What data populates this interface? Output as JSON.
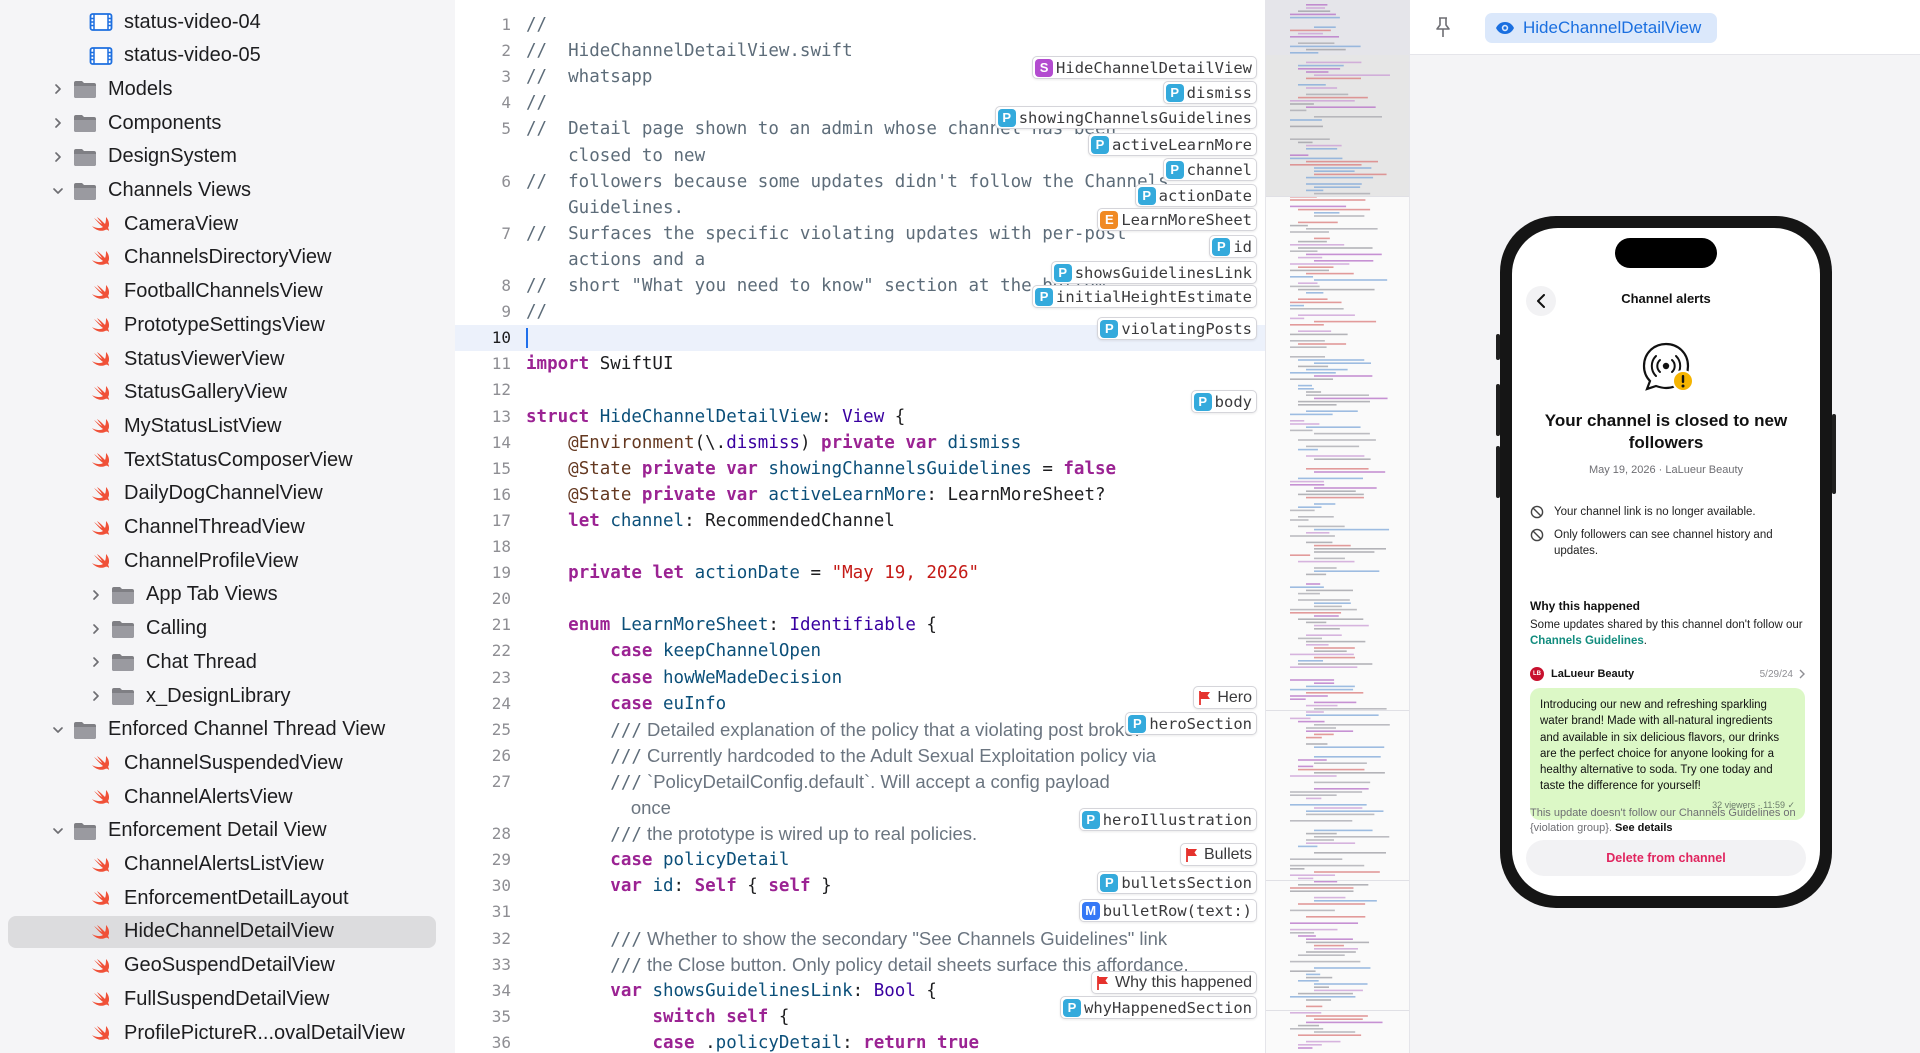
{
  "sidebar": {
    "items": [
      {
        "label": "status-video-04",
        "icon": "video-file-icon",
        "indent": 2,
        "chevron": "none"
      },
      {
        "label": "status-video-05",
        "icon": "video-file-icon",
        "indent": 2,
        "chevron": "none"
      },
      {
        "label": "Models",
        "icon": "folder-icon",
        "indent": 1,
        "chevron": "closed"
      },
      {
        "label": "Components",
        "icon": "folder-icon",
        "indent": 1,
        "chevron": "closed"
      },
      {
        "label": "DesignSystem",
        "icon": "folder-icon",
        "indent": 1,
        "chevron": "closed"
      },
      {
        "label": "Channels Views",
        "icon": "folder-icon",
        "indent": 1,
        "chevron": "open"
      },
      {
        "label": "CameraView",
        "icon": "swift-file-icon",
        "indent": 2,
        "chevron": "none"
      },
      {
        "label": "ChannelsDirectoryView",
        "icon": "swift-file-icon",
        "indent": 2,
        "chevron": "none"
      },
      {
        "label": "FootballChannelsView",
        "icon": "swift-file-icon",
        "indent": 2,
        "chevron": "none"
      },
      {
        "label": "PrototypeSettingsView",
        "icon": "swift-file-icon",
        "indent": 2,
        "chevron": "none"
      },
      {
        "label": "StatusViewerView",
        "icon": "swift-file-icon",
        "indent": 2,
        "chevron": "none"
      },
      {
        "label": "StatusGalleryView",
        "icon": "swift-file-icon",
        "indent": 2,
        "chevron": "none"
      },
      {
        "label": "MyStatusListView",
        "icon": "swift-file-icon",
        "indent": 2,
        "chevron": "none"
      },
      {
        "label": "TextStatusComposerView",
        "icon": "swift-file-icon",
        "indent": 2,
        "chevron": "none"
      },
      {
        "label": "DailyDogChannelView",
        "icon": "swift-file-icon",
        "indent": 2,
        "chevron": "none"
      },
      {
        "label": "ChannelThreadView",
        "icon": "swift-file-icon",
        "indent": 2,
        "chevron": "none"
      },
      {
        "label": "ChannelProfileView",
        "icon": "swift-file-icon",
        "indent": 2,
        "chevron": "none"
      },
      {
        "label": "App Tab Views",
        "icon": "folder-icon",
        "indent": 2,
        "chevron": "closed"
      },
      {
        "label": "Calling",
        "icon": "folder-icon",
        "indent": 2,
        "chevron": "closed"
      },
      {
        "label": "Chat Thread",
        "icon": "folder-icon",
        "indent": 2,
        "chevron": "closed"
      },
      {
        "label": "x_DesignLibrary",
        "icon": "folder-icon",
        "indent": 2,
        "chevron": "closed"
      },
      {
        "label": "Enforced Channel Thread View",
        "icon": "folder-icon",
        "indent": 1,
        "chevron": "open"
      },
      {
        "label": "ChannelSuspendedView",
        "icon": "swift-file-icon",
        "indent": 2,
        "chevron": "none"
      },
      {
        "label": "ChannelAlertsView",
        "icon": "swift-file-icon",
        "indent": 2,
        "chevron": "none"
      },
      {
        "label": "Enforcement Detail View",
        "icon": "folder-icon",
        "indent": 1,
        "chevron": "open"
      },
      {
        "label": "ChannelAlertsListView",
        "icon": "swift-file-icon",
        "indent": 2,
        "chevron": "none"
      },
      {
        "label": "EnforcementDetailLayout",
        "icon": "swift-file-icon",
        "indent": 2,
        "chevron": "none"
      },
      {
        "label": "HideChannelDetailView",
        "icon": "swift-file-icon",
        "indent": 2,
        "chevron": "none",
        "selected": true
      },
      {
        "label": "GeoSuspendDetailView",
        "icon": "swift-file-icon",
        "indent": 2,
        "chevron": "none"
      },
      {
        "label": "FullSuspendDetailView",
        "icon": "swift-file-icon",
        "indent": 2,
        "chevron": "none"
      },
      {
        "label": "ProfilePictureR...ovalDetailView",
        "icon": "swift-file-icon",
        "indent": 2,
        "chevron": "none"
      }
    ]
  },
  "editor": {
    "current_line": 10,
    "lines": [
      {
        "n": "1",
        "segs": [
          [
            "c",
            "//"
          ]
        ]
      },
      {
        "n": "2",
        "segs": [
          [
            "c",
            "//  HideChannelDetailView.swift"
          ]
        ]
      },
      {
        "n": "3",
        "segs": [
          [
            "c",
            "//  whatsapp"
          ]
        ]
      },
      {
        "n": "4",
        "segs": [
          [
            "c",
            "//"
          ]
        ]
      },
      {
        "n": "5",
        "segs": [
          [
            "c",
            "//  Detail page shown to an admin whose channel has been"
          ]
        ]
      },
      {
        "n": "",
        "segs": [
          [
            "c",
            "    closed to new"
          ]
        ]
      },
      {
        "n": "6",
        "segs": [
          [
            "c",
            "//  followers because some updates didn't follow the Channels"
          ]
        ]
      },
      {
        "n": "",
        "segs": [
          [
            "c",
            "    Guidelines."
          ]
        ]
      },
      {
        "n": "7",
        "segs": [
          [
            "c",
            "//  Surfaces the specific violating updates with per-post"
          ]
        ]
      },
      {
        "n": "",
        "segs": [
          [
            "c",
            "    actions and a"
          ]
        ]
      },
      {
        "n": "8",
        "segs": [
          [
            "c",
            "//  short \"What you need to know\" section at the bottom."
          ]
        ]
      },
      {
        "n": "9",
        "segs": [
          [
            "c",
            "//"
          ]
        ]
      },
      {
        "n": "10",
        "segs": []
      },
      {
        "n": "11",
        "segs": [
          [
            "k",
            "import"
          ],
          [
            "",
            " SwiftUI"
          ]
        ]
      },
      {
        "n": "12",
        "segs": []
      },
      {
        "n": "13",
        "segs": [
          [
            "k",
            "struct"
          ],
          [
            "",
            " "
          ],
          [
            "t",
            "HideChannelDetailView"
          ],
          [
            "",
            ": "
          ],
          [
            "p",
            "View"
          ],
          [
            "",
            " {"
          ]
        ]
      },
      {
        "n": "14",
        "segs": [
          [
            "",
            "    "
          ],
          [
            "a",
            "@Environment"
          ],
          [
            "",
            "(\\."
          ],
          [
            "p",
            "dismiss"
          ],
          [
            "",
            ") "
          ],
          [
            "k",
            "private var"
          ],
          [
            "",
            " "
          ],
          [
            "t",
            "dismiss"
          ]
        ]
      },
      {
        "n": "15",
        "segs": [
          [
            "",
            "    "
          ],
          [
            "a",
            "@State"
          ],
          [
            "",
            " "
          ],
          [
            "k",
            "private var"
          ],
          [
            "",
            " "
          ],
          [
            "t",
            "showingChannelsGuidelines"
          ],
          [
            "",
            " = "
          ],
          [
            "k",
            "false"
          ]
        ]
      },
      {
        "n": "16",
        "segs": [
          [
            "",
            "    "
          ],
          [
            "a",
            "@State"
          ],
          [
            "",
            " "
          ],
          [
            "k",
            "private var"
          ],
          [
            "",
            " "
          ],
          [
            "t",
            "activeLearnMore"
          ],
          [
            "",
            ": LearnMoreSheet?"
          ]
        ]
      },
      {
        "n": "17",
        "segs": [
          [
            "",
            "    "
          ],
          [
            "k",
            "let"
          ],
          [
            "",
            " "
          ],
          [
            "t",
            "channel"
          ],
          [
            "",
            ": RecommendedChannel"
          ]
        ]
      },
      {
        "n": "18",
        "segs": []
      },
      {
        "n": "19",
        "segs": [
          [
            "",
            "    "
          ],
          [
            "k",
            "private let"
          ],
          [
            "",
            " "
          ],
          [
            "t",
            "actionDate"
          ],
          [
            "",
            " = "
          ],
          [
            "s",
            "\"May 19, 2026\""
          ]
        ]
      },
      {
        "n": "20",
        "segs": []
      },
      {
        "n": "21",
        "segs": [
          [
            "",
            "    "
          ],
          [
            "k",
            "enum"
          ],
          [
            "",
            " "
          ],
          [
            "t",
            "LearnMoreSheet"
          ],
          [
            "",
            ": "
          ],
          [
            "p",
            "Identifiable"
          ],
          [
            "",
            " {"
          ]
        ]
      },
      {
        "n": "22",
        "segs": [
          [
            "",
            "        "
          ],
          [
            "k",
            "case"
          ],
          [
            "",
            " "
          ],
          [
            "t",
            "keepChannelOpen"
          ]
        ]
      },
      {
        "n": "23",
        "segs": [
          [
            "",
            "        "
          ],
          [
            "k",
            "case"
          ],
          [
            "",
            " "
          ],
          [
            "t",
            "howWeMadeDecision"
          ]
        ]
      },
      {
        "n": "24",
        "segs": [
          [
            "",
            "        "
          ],
          [
            "k",
            "case"
          ],
          [
            "",
            " "
          ],
          [
            "t",
            "euInfo"
          ]
        ]
      },
      {
        "n": "25",
        "segs": [
          [
            "",
            "        "
          ],
          [
            "c",
            "///"
          ],
          [
            "d",
            " Detailed explanation of the policy that a violating post broke."
          ]
        ]
      },
      {
        "n": "26",
        "segs": [
          [
            "",
            "        "
          ],
          [
            "c",
            "///"
          ],
          [
            "d",
            " Currently hardcoded to the Adult Sexual Exploitation policy via"
          ]
        ]
      },
      {
        "n": "27",
        "segs": [
          [
            "",
            "        "
          ],
          [
            "c",
            "///"
          ],
          [
            "d",
            " `PolicyDetailConfig.default`. Will accept a config payload"
          ]
        ]
      },
      {
        "n": "",
        "segs": [
          [
            "",
            "        "
          ],
          [
            "d",
            "    once"
          ]
        ]
      },
      {
        "n": "28",
        "segs": [
          [
            "",
            "        "
          ],
          [
            "c",
            "///"
          ],
          [
            "d",
            " the prototype is wired up to real policies."
          ]
        ]
      },
      {
        "n": "29",
        "segs": [
          [
            "",
            "        "
          ],
          [
            "k",
            "case"
          ],
          [
            "",
            " "
          ],
          [
            "t",
            "policyDetail"
          ]
        ]
      },
      {
        "n": "30",
        "segs": [
          [
            "",
            "        "
          ],
          [
            "k",
            "var"
          ],
          [
            "",
            " "
          ],
          [
            "t",
            "id"
          ],
          [
            "",
            ": "
          ],
          [
            "k",
            "Self"
          ],
          [
            "",
            " { "
          ],
          [
            "k",
            "self"
          ],
          [
            "",
            " }"
          ]
        ]
      },
      {
        "n": "31",
        "segs": []
      },
      {
        "n": "32",
        "segs": [
          [
            "",
            "        "
          ],
          [
            "c",
            "///"
          ],
          [
            "d",
            " Whether to show the secondary \"See Channels Guidelines\" link"
          ]
        ]
      },
      {
        "n": "33",
        "segs": [
          [
            "",
            "        "
          ],
          [
            "c",
            "///"
          ],
          [
            "d",
            " the Close button. Only policy detail sheets surface this affordance."
          ]
        ]
      },
      {
        "n": "34",
        "segs": [
          [
            "",
            "        "
          ],
          [
            "k",
            "var"
          ],
          [
            "",
            " "
          ],
          [
            "t",
            "showsGuidelinesLink"
          ],
          [
            "",
            ": "
          ],
          [
            "p",
            "Bool"
          ],
          [
            "",
            " {"
          ]
        ]
      },
      {
        "n": "35",
        "segs": [
          [
            "",
            "            "
          ],
          [
            "k",
            "switch self"
          ],
          [
            "",
            " {"
          ]
        ]
      },
      {
        "n": "36",
        "segs": [
          [
            "",
            "            "
          ],
          [
            "k",
            "case"
          ],
          [
            "",
            " ."
          ],
          [
            "t",
            "policyDetail"
          ],
          [
            "",
            ": "
          ],
          [
            "k",
            "return true"
          ]
        ]
      }
    ],
    "outline": [
      {
        "kind": "S",
        "label": "HideChannelDetailView",
        "color": "#b34cd0"
      },
      {
        "kind": "P",
        "label": "dismiss",
        "color": "#34aadc"
      },
      {
        "kind": "P",
        "label": "showingChannelsGuidelines",
        "color": "#34aadc"
      },
      {
        "kind": "P",
        "label": "activeLearnMore",
        "color": "#34aadc"
      },
      {
        "kind": "P",
        "label": "channel",
        "color": "#34aadc"
      },
      {
        "kind": "P",
        "label": "actionDate",
        "color": "#34aadc"
      },
      {
        "kind": "E",
        "label": "LearnMoreSheet",
        "color": "#f08a24"
      },
      {
        "kind": "P",
        "label": "id",
        "color": "#34aadc"
      },
      {
        "kind": "P",
        "label": "showsGuidelinesLink",
        "color": "#34aadc"
      },
      {
        "kind": "P",
        "label": "initialHeightEstimate",
        "color": "#34aadc"
      },
      {
        "kind": "P",
        "label": "violatingPosts",
        "color": "#34aadc"
      },
      {
        "kind": "P",
        "label": "body",
        "color": "#34aadc"
      },
      {
        "kind": "flag",
        "label": "Hero",
        "color": "#e5322d"
      },
      {
        "kind": "P",
        "label": "heroSection",
        "color": "#34aadc"
      },
      {
        "kind": "P",
        "label": "heroIllustration",
        "color": "#34aadc"
      },
      {
        "kind": "flag",
        "label": "Bullets",
        "color": "#e5322d"
      },
      {
        "kind": "P",
        "label": "bulletsSection",
        "color": "#34aadc"
      },
      {
        "kind": "M",
        "label": "bulletRow(text:)",
        "color": "#3478f6"
      },
      {
        "kind": "flag",
        "label": "Why this happened",
        "color": "#e5322d"
      },
      {
        "kind": "P",
        "label": "whyHappenedSection",
        "color": "#34aadc"
      }
    ]
  },
  "canvas": {
    "pin_icon": "pin-icon",
    "preview_label": "HideChannelDetailView",
    "preview_icon": "eye-icon"
  },
  "phone": {
    "nav_title": "Channel alerts",
    "headline": "Your channel is closed to new followers",
    "meta": "May 19, 2026 · LaLueur Beauty",
    "bullets": [
      "Your channel link is no longer available.",
      "Only followers can see channel history and updates."
    ],
    "why_title": "Why this happened",
    "why_body_prefix": "Some updates shared by this channel don't follow our ",
    "why_body_link": "Channels Guidelines",
    "why_body_suffix": ".",
    "post": {
      "avatar": "LB",
      "name": "LaLueur Beauty",
      "date": "5/29/24",
      "text": "Introducing our new and refreshing sparkling water brand! Made with all-natural ingredients and available in six delicious flavors, our drinks are the perfect choice for anyone looking for a healthy alternative to soda. Try one today and taste the difference for yourself!",
      "footer": "32 viewers · 11:59 ✓"
    },
    "notice_prefix": "This update doesn't follow our Channels Guidelines on {violation group}. ",
    "notice_link": "See details",
    "delete_label": "Delete from channel"
  },
  "colors": {
    "accent": "#1a6fe0",
    "swift": "#f05138",
    "folder": "#8e8e93",
    "whatsapp_green": "#128c7e",
    "bubble": "#dcf8c6",
    "destructive": "#e0245e"
  }
}
